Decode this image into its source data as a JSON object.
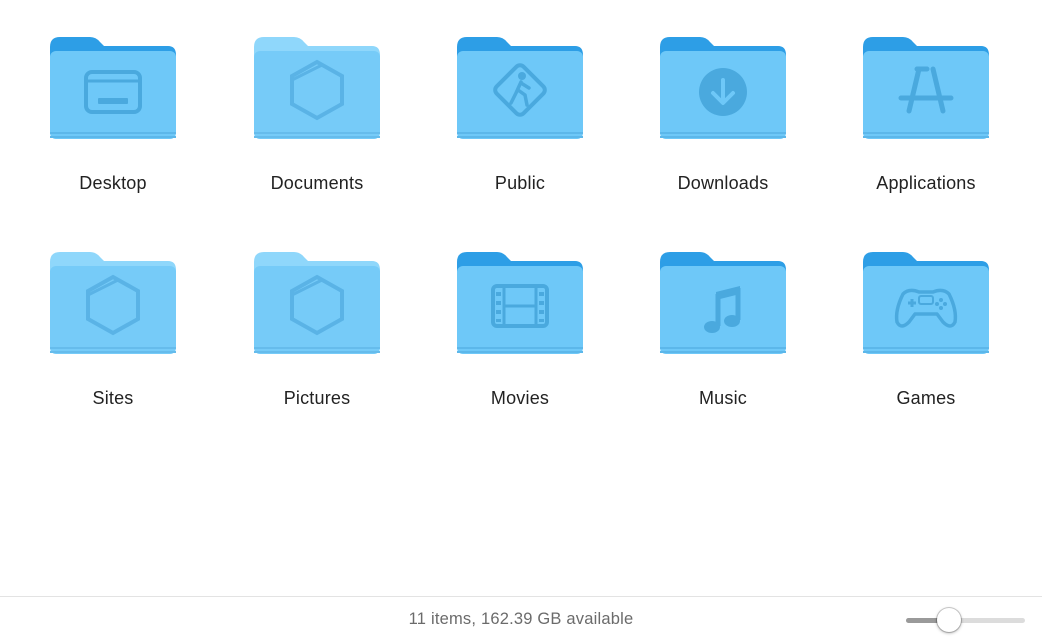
{
  "colors": {
    "folder_back": "#2d9ee6",
    "folder_front": "#6ec8f8",
    "folder_light_back": "#8fd7fb",
    "folder_light_front": "#76cbf8",
    "glyph": "#4aa9de",
    "slider_fill": "#9a9a9a"
  },
  "items": [
    {
      "name": "Desktop",
      "icon": "desktop-icon",
      "style": "dark"
    },
    {
      "name": "Documents",
      "icon": "document-hexagon-icon",
      "style": "light"
    },
    {
      "name": "Public",
      "icon": "pedestrian-sign-icon",
      "style": "dark"
    },
    {
      "name": "Downloads",
      "icon": "download-arrow-icon",
      "style": "dark"
    },
    {
      "name": "Applications",
      "icon": "app-store-icon",
      "style": "dark"
    },
    {
      "name": "Sites",
      "icon": "document-hexagon-icon",
      "style": "light"
    },
    {
      "name": "Pictures",
      "icon": "document-hexagon-icon",
      "style": "light"
    },
    {
      "name": "Movies",
      "icon": "film-strip-icon",
      "style": "dark"
    },
    {
      "name": "Music",
      "icon": "music-note-icon",
      "style": "dark"
    },
    {
      "name": "Games",
      "icon": "game-controller-icon",
      "style": "dark"
    }
  ],
  "status": {
    "text": "11 items, 162.39 GB available"
  },
  "zoom_slider": {
    "value_fraction": 0.36
  }
}
